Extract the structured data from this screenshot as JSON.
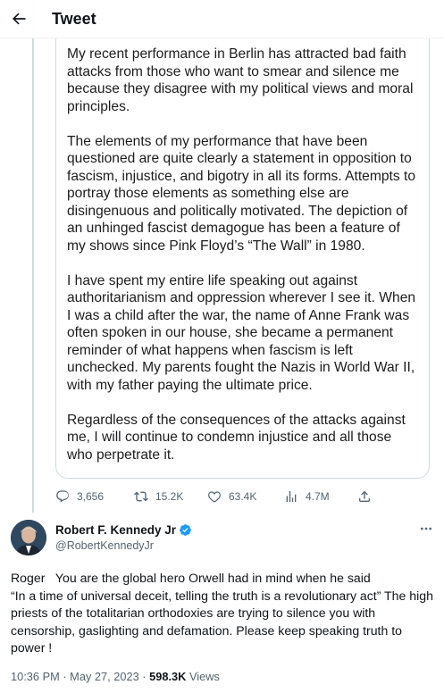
{
  "header": {
    "title": "Tweet"
  },
  "quoted_image": {
    "paragraphs": [
      "My recent performance in Berlin has attracted bad faith attacks from those who want to smear and silence me because they disagree with my political views and moral principles.",
      "The elements of my performance that have been questioned are quite clearly a statement in opposition to fascism, injustice, and bigotry in all its forms. Attempts to portray those elements as something else are disingenuous and politically motivated. The depiction of an unhinged fascist demagogue has been a feature of my shows since Pink Floyd’s “The Wall” in 1980.",
      "I have spent my entire life speaking out against authoritarianism and oppression wherever I see it. When I was a child after the war, the name of Anne Frank was often spoken in our house, she became a permanent reminder of what happens when fascism is left unchecked. My parents fought the Nazis in World War II, with my father paying the ultimate price.",
      "Regardless of the consequences of the attacks against me, I will continue to condemn injustice and all those who perpetrate it."
    ]
  },
  "metrics": {
    "replies": "3,656",
    "retweets": "15.2K",
    "likes": "63.4K",
    "views": "4.7M"
  },
  "reply": {
    "author_name": "Robert F. Kennedy Jr",
    "author_handle": "@RobertKennedyJr",
    "text": "Roger   You are the global hero Orwell had in mind when he said\n“In a time of universal deceit, telling the truth is a revolutionary act” The high priests of the totalitarian orthodoxies are trying to silence you with censorship, gaslighting and defamation. Please keep speaking truth to power !",
    "time": "10:36 PM",
    "date": "May 27, 2023",
    "views_count": "598.3K",
    "views_label": "Views"
  },
  "colors": {
    "text": "#0f1419",
    "secondary": "#536471",
    "border": "#cfd9de",
    "verified": "#1d9bf0"
  }
}
